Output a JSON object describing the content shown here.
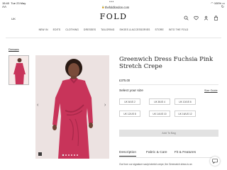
{
  "status_bar": {
    "time": "15:40",
    "date": "Tue 23 May",
    "battery": "100%"
  },
  "browser": {
    "text_size_label": "AA",
    "url": "thefoldlondon.com"
  },
  "header": {
    "locale": "UK",
    "logo": "FOLD"
  },
  "nav": [
    "NEW IN",
    "EDITS",
    "CLOTHING",
    "DRESSES",
    "TAILORING",
    "SHOES & ACCESSORIES",
    "STORE",
    "INTO THE FOLD"
  ],
  "breadcrumb": "Dresses",
  "product": {
    "title": "Greenwich Dress Fuchsia Pink Stretch Crepe",
    "price": "£375.00",
    "size_label": "Select your size",
    "size_guide": "Size Guide",
    "sizes": [
      "UK 6/US 2",
      "UK 8/US 4",
      "UK 10/US 6",
      "UK 12/US 8",
      "UK 14/US 10",
      "UK 16/US 12"
    ],
    "add_to_bag": "Add To Bag",
    "tabs": [
      "Description",
      "Fabric & Care",
      "Fit & Features"
    ],
    "description": "Our from our signature sculpt stretch crepe, the Greenwich dress is an"
  },
  "colors": {
    "dress": "#c8345a",
    "dress_dark": "#a82749",
    "background": "#ece2e1"
  }
}
